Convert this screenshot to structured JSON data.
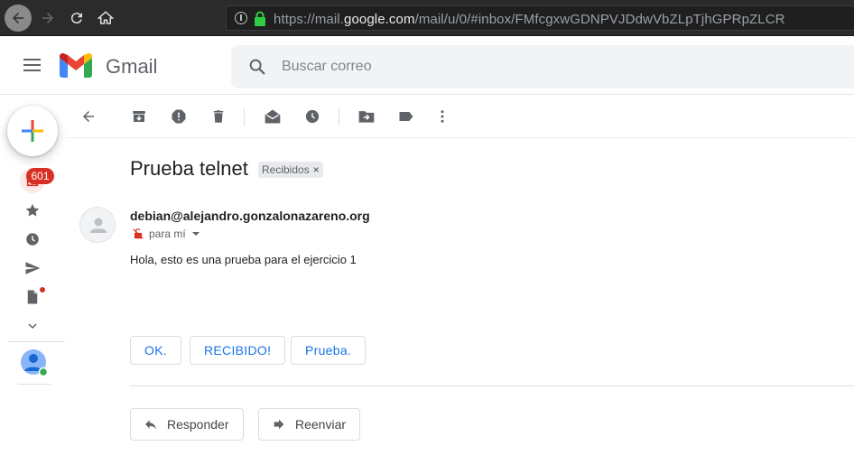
{
  "browser": {
    "url_prefix": "https://mail.",
    "url_domain": "google.com",
    "url_path": "/mail/u/0/#inbox/FMfcgxwGDNPVJDdwVbZLpTjhGPRpZLCR"
  },
  "header": {
    "brand": "Gmail",
    "search_placeholder": "Buscar correo"
  },
  "rail": {
    "inbox_badge": "601"
  },
  "message": {
    "subject": "Prueba telnet",
    "label": "Recibidos",
    "label_close": "×",
    "sender": "debian@alejandro.gonzalonazareno.org",
    "to": "para mí",
    "body": "Hola, esto es una prueba para el ejercicio 1"
  },
  "smart_replies": [
    "OK.",
    "RECIBIDO!",
    "Prueba."
  ],
  "actions": {
    "reply": "Responder",
    "forward": "Reenviar"
  },
  "colors": {
    "accent": "#1a73e8",
    "badge": "#d93025",
    "chrome_bg": "#2b2b2b",
    "lock": "#2ecc40"
  }
}
